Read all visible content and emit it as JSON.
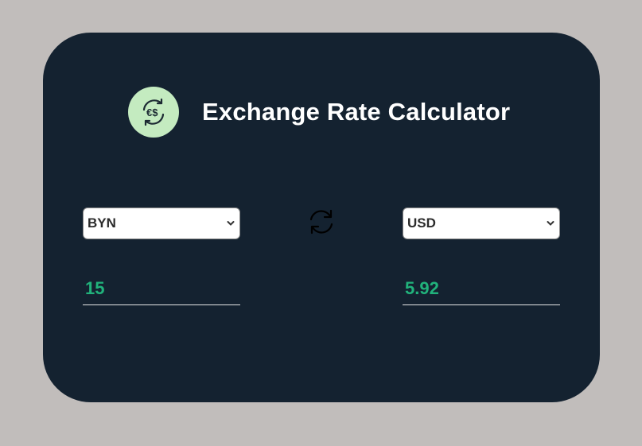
{
  "app": {
    "title": "Exchange Rate Calculator",
    "logo_icon": "currency-exchange-icon",
    "logo_bg_color": "#c4ebc0",
    "card_color": "#142230",
    "accent_color": "#21b27b"
  },
  "from": {
    "currency": "BYN",
    "amount": "15"
  },
  "to": {
    "currency": "USD",
    "amount": "5.92"
  },
  "swap": {
    "icon": "swap-arrows-icon"
  }
}
